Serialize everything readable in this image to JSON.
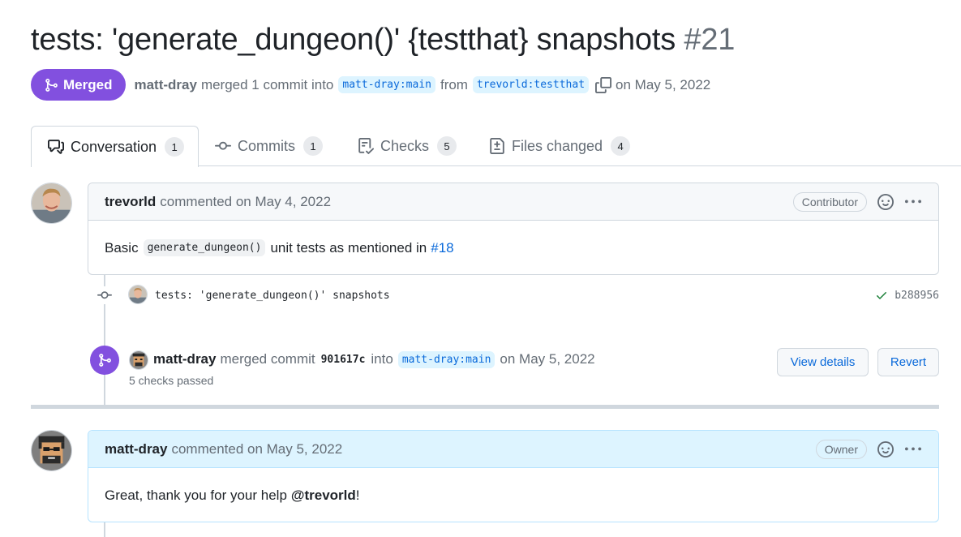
{
  "pr": {
    "title": "tests: 'generate_dungeon()' {testthat} snapshots",
    "number": "#21",
    "state": "Merged",
    "author": "matt-dray",
    "merged_text": "merged 1 commit into",
    "base_branch": "matt-dray:main",
    "from_text": "from",
    "head_branch": "trevorld:testthat",
    "date_text": "on May 5, 2022"
  },
  "tabs": [
    {
      "label": "Conversation",
      "count": "1",
      "icon": "comment-discussion-icon"
    },
    {
      "label": "Commits",
      "count": "1",
      "icon": "git-commit-icon"
    },
    {
      "label": "Checks",
      "count": "5",
      "icon": "checklist-icon"
    },
    {
      "label": "Files changed",
      "count": "4",
      "icon": "file-diff-icon"
    }
  ],
  "comments": [
    {
      "author": "trevorld",
      "action": "commented on May 4, 2022",
      "role": "Contributor",
      "body_prefix": "Basic",
      "body_code": "generate_dungeon()",
      "body_middle": "unit tests as mentioned in",
      "body_link": "#18"
    },
    {
      "author": "matt-dray",
      "action": "commented on May 5, 2022",
      "role": "Owner",
      "body_prefix": "Great, thank you for your help",
      "body_mention": "@trevorld",
      "body_suffix": "!"
    }
  ],
  "commit_event": {
    "message": "tests: 'generate_dungeon()' snapshots",
    "sha": "b288956"
  },
  "merge_event": {
    "author": "matt-dray",
    "text_merged": "merged commit",
    "sha": "901617c",
    "text_into": "into",
    "branch": "matt-dray:main",
    "date": "on May 5, 2022",
    "checks": "5 checks passed",
    "view_details": "View details",
    "revert": "Revert"
  },
  "colors": {
    "merged_purple": "#8250df",
    "link_blue": "#0969da",
    "branch_bg": "#ddf4ff",
    "check_green": "#1a7f37"
  }
}
